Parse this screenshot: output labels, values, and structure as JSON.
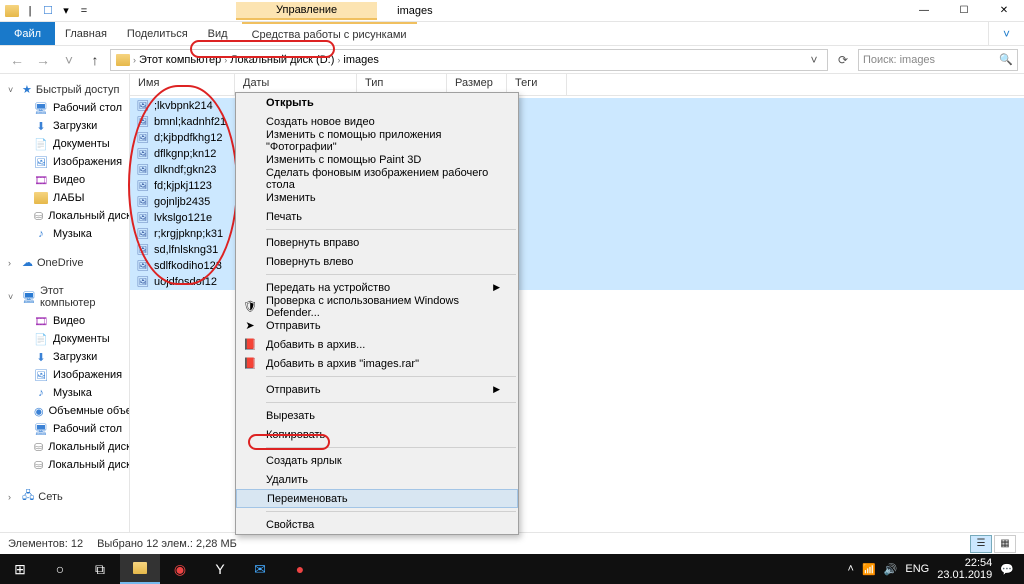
{
  "title_bar": {
    "management_tab": "Управление",
    "folder_name": "images",
    "min": "—",
    "max": "☐",
    "close": "✕"
  },
  "ribbon": {
    "file": "Файл",
    "home": "Главная",
    "share": "Поделиться",
    "view": "Вид",
    "picture_tools": "Средства работы с рисунками"
  },
  "addr": {
    "this_pc": "Этот компьютер",
    "local_disk": "Локальный диск (D:)",
    "images": "images"
  },
  "search": {
    "placeholder": "Поиск: images"
  },
  "nav": {
    "quick_access": "Быстрый доступ",
    "desktop": "Рабочий стол",
    "downloads": "Загрузки",
    "documents": "Документы",
    "pictures": "Изображения",
    "video": "Видео",
    "labs": "ЛАБЫ",
    "local_disk_d": "Локальный диск (D:)",
    "music": "Музыка",
    "onedrive": "OneDrive",
    "this_pc": "Этот компьютер",
    "video2": "Видео",
    "documents2": "Документы",
    "downloads2": "Загрузки",
    "pictures2": "Изображения",
    "music2": "Музыка",
    "objects3d": "Объемные объекты",
    "desktop2": "Рабочий стол",
    "local_disk_c": "Локальный диск (C:)",
    "local_disk_d2": "Локальный диск (D:)",
    "network": "Сеть"
  },
  "columns": {
    "name": "Имя",
    "date": "Даты",
    "type": "Тип",
    "size": "Размер",
    "tags": "Теги"
  },
  "files": [
    ";lkvbpnk214",
    "bmnl;kadnhf21",
    "d;kjbpdfkhg12",
    "dflkgnp;kn12",
    "dlkndf;gkn23",
    "fd;kjpkj1123",
    "gojnljb2435",
    "lvkslgo121e",
    "r;krgjpknp;k31",
    "sd,lfnlskng31",
    "sdlfkodiho123",
    "uojdfosdof12"
  ],
  "context_menu": {
    "open": "Открыть",
    "create_video": "Создать новое видео",
    "edit_photos": "Изменить с помощью приложения \"Фотографии\"",
    "edit_paint3d": "Изменить с помощью Paint 3D",
    "set_bg": "Сделать фоновым изображением рабочего стола",
    "edit": "Изменить",
    "print": "Печать",
    "rotate_right": "Повернуть вправо",
    "rotate_left": "Повернуть влево",
    "cast": "Передать на устройство",
    "defender": "Проверка с использованием Windows Defender...",
    "send": "Отправить",
    "add_archive": "Добавить в архив...",
    "add_archive_named": "Добавить в архив \"images.rar\"",
    "send_to": "Отправить",
    "cut": "Вырезать",
    "copy": "Копировать",
    "shortcut": "Создать ярлык",
    "delete": "Удалить",
    "rename": "Переименовать",
    "properties": "Свойства"
  },
  "status": {
    "count": "Элементов: 12",
    "selection": "Выбрано 12 элем.: 2,28 МБ"
  },
  "tray": {
    "lang": "ENG",
    "time": "22:54",
    "date": "23.01.2019"
  }
}
